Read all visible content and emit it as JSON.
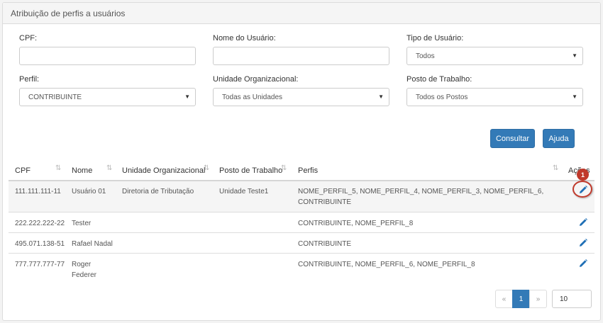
{
  "panel": {
    "title": "Atribuição de perfis a usuários"
  },
  "filters": {
    "cpf": {
      "label": "CPF:",
      "value": "",
      "placeholder": ""
    },
    "nome": {
      "label": "Nome do Usuário:",
      "value": "",
      "placeholder": ""
    },
    "tipo": {
      "label": "Tipo de Usuário:",
      "selected": "Todos"
    },
    "perfil": {
      "label": "Perfil:",
      "selected": "CONTRIBUINTE"
    },
    "unidade": {
      "label": "Unidade Organizacional:",
      "selected": "Todas as Unidades"
    },
    "posto": {
      "label": "Posto de Trabalho:",
      "selected": "Todos os Postos"
    }
  },
  "buttons": {
    "consultar": "Consultar",
    "ajuda": "Ajuda"
  },
  "table": {
    "headers": {
      "cpf": "CPF",
      "nome": "Nome",
      "unidade": "Unidade Organizacional",
      "posto": "Posto de Trabalho",
      "perfis": "Perfis",
      "acoes": "Ações"
    },
    "rows": [
      {
        "cpf": "111.111.111-11",
        "nome": "Usuário 01",
        "nome2": "",
        "unidade": "Diretoria de Tributação",
        "posto": "Unidade Teste1",
        "perfis": "NOME_PERFIL_5, NOME_PERFIL_4, NOME_PERFIL_3, NOME_PERFIL_6,",
        "perfis2": "CONTRIBUINTE"
      },
      {
        "cpf": "222.222.222-22",
        "nome": "Tester",
        "nome2": "",
        "unidade": "",
        "posto": "",
        "perfis": "CONTRIBUINTE, NOME_PERFIL_8",
        "perfis2": ""
      },
      {
        "cpf": "495.071.138-51",
        "nome": "Rafael Nadal",
        "nome2": "",
        "unidade": "",
        "posto": "",
        "perfis": "CONTRIBUINTE",
        "perfis2": ""
      },
      {
        "cpf": "777.777.777-77",
        "nome": "Roger",
        "nome2": "Federer",
        "unidade": "",
        "posto": "",
        "perfis": "CONTRIBUINTE, NOME_PERFIL_6, NOME_PERFIL_8",
        "perfis2": ""
      }
    ]
  },
  "annotation": {
    "badge": "1"
  },
  "pagination": {
    "prev": "«",
    "current": "1",
    "next": "»",
    "page_size": "10"
  },
  "icons": {
    "sort": "sort-icon",
    "edit": "pencil-icon",
    "caret": "caret-down-icon"
  },
  "colors": {
    "primary": "#337ab7",
    "highlight": "#c0392b"
  }
}
